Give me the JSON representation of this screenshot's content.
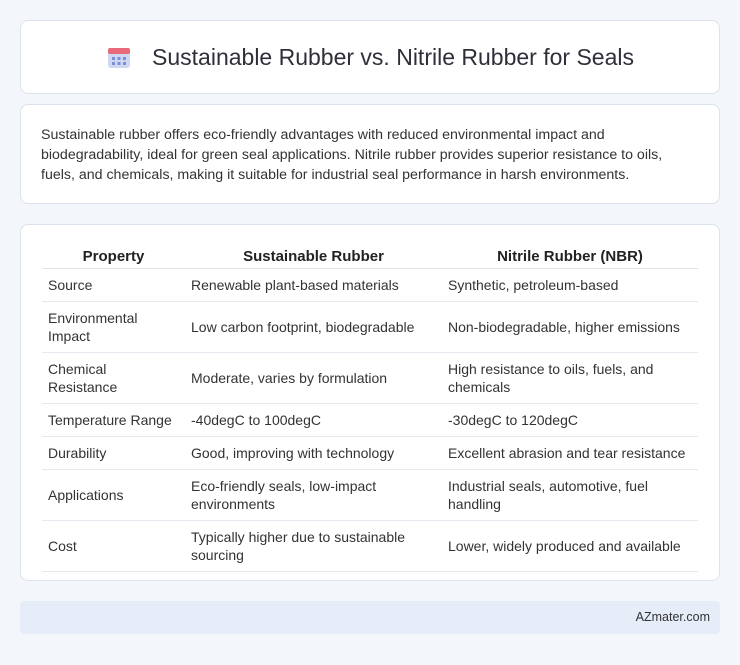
{
  "header": {
    "title": "Sustainable Rubber vs. Nitrile Rubber for Seals",
    "icon": "calendar-icon",
    "icon_colors": {
      "top": "#e86a7a",
      "body": "#cfd8f2",
      "dots": "#7b8fd9"
    }
  },
  "intro": {
    "text": "Sustainable rubber offers eco-friendly advantages with reduced environmental impact and biodegradability, ideal for green seal applications. Nitrile rubber provides superior resistance to oils, fuels, and chemicals, making it suitable for industrial seal performance in harsh environments."
  },
  "table": {
    "headers": [
      "Property",
      "Sustainable Rubber",
      "Nitrile Rubber (NBR)"
    ],
    "rows": [
      [
        "Source",
        "Renewable plant-based materials",
        "Synthetic, petroleum-based"
      ],
      [
        "Environmental Impact",
        "Low carbon footprint, biodegradable",
        "Non-biodegradable, higher emissions"
      ],
      [
        "Chemical Resistance",
        "Moderate, varies by formulation",
        "High resistance to oils, fuels, and chemicals"
      ],
      [
        "Temperature Range",
        "-40degC to 100degC",
        "-30degC to 120degC"
      ],
      [
        "Durability",
        "Good, improving with technology",
        "Excellent abrasion and tear resistance"
      ],
      [
        "Applications",
        "Eco-friendly seals, low-impact environments",
        "Industrial seals, automotive, fuel handling"
      ],
      [
        "Cost",
        "Typically higher due to sustainable sourcing",
        "Lower, widely produced and available"
      ]
    ]
  },
  "footer": {
    "text": "AZmater.com"
  }
}
